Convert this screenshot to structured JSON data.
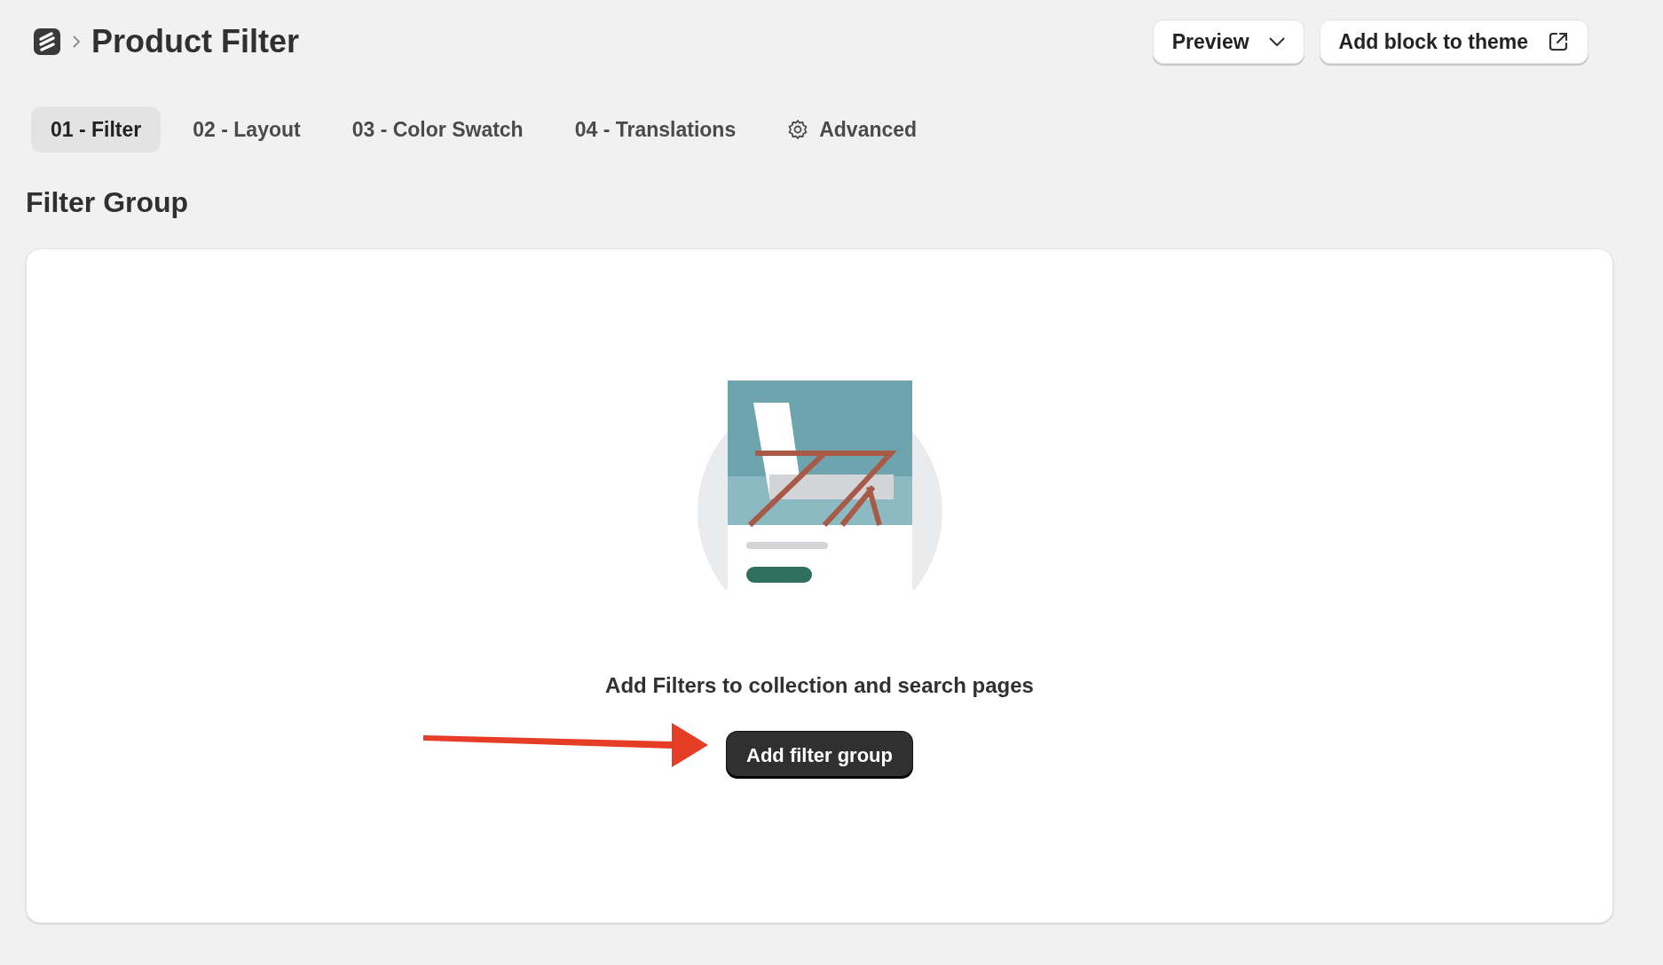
{
  "breadcrumb": {
    "title": "Product Filter"
  },
  "actions": [
    {
      "kind": "dropdown",
      "label": "Preview"
    },
    {
      "kind": "external",
      "label": "Add block to theme"
    }
  ],
  "tabs": [
    {
      "label": "01 - Filter",
      "selected": true,
      "kind": "plain"
    },
    {
      "label": "02 - Layout",
      "selected": false,
      "kind": "plain"
    },
    {
      "label": "03 - Color Swatch",
      "selected": false,
      "kind": "plain"
    },
    {
      "label": "04 - Translations",
      "selected": false,
      "kind": "plain"
    },
    {
      "label": "Advanced",
      "selected": false,
      "kind": "settings"
    }
  ],
  "section": {
    "heading": "Filter Group"
  },
  "empty_state": {
    "message": "Add Filters to collection and search pages",
    "button": "Add filter group"
  }
}
